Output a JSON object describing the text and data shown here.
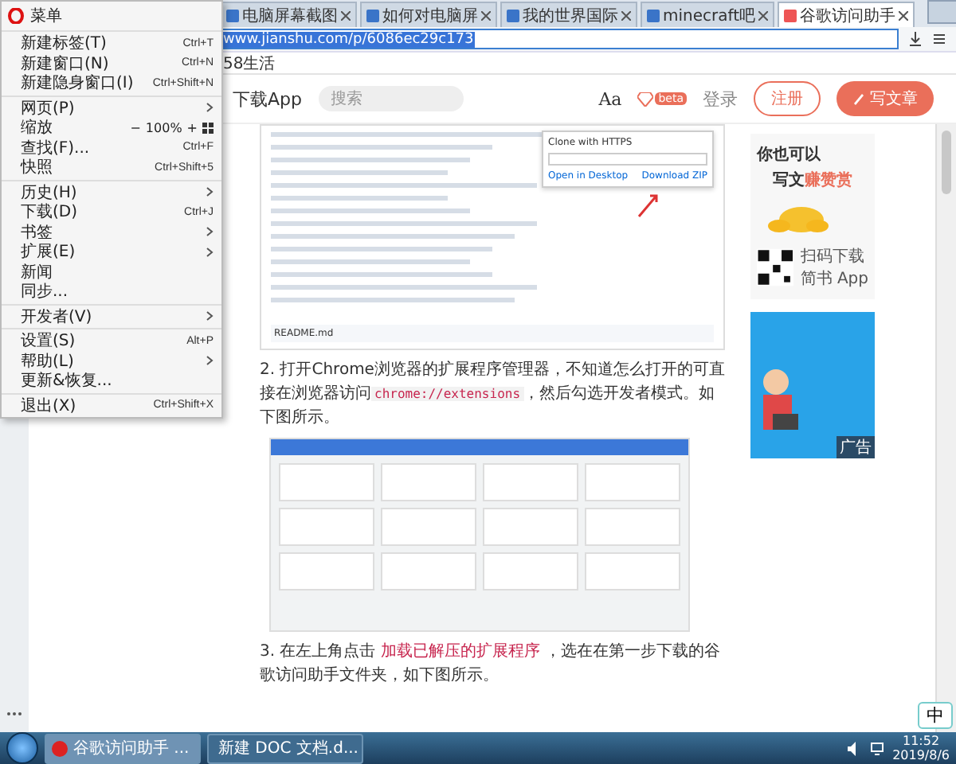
{
  "browser": {
    "tabs": [
      {
        "title": "电脑屏幕截图",
        "selected": false
      },
      {
        "title": "如何对电脑屏",
        "selected": false
      },
      {
        "title": "我的世界国际",
        "selected": false
      },
      {
        "title": "minecraft吧",
        "selected": false
      },
      {
        "title": "谷歌访问助手",
        "selected": true
      }
    ],
    "address": "www.jianshu.com/p/6086ec29c173",
    "bookmarks": [
      "58生活"
    ]
  },
  "menu": {
    "title": "菜单",
    "groups": [
      [
        {
          "kind": "item",
          "label": "新建标签(T)",
          "shortcut": "Ctrl+T"
        },
        {
          "kind": "item",
          "label": "新建窗口(N)",
          "shortcut": "Ctrl+N"
        },
        {
          "kind": "item",
          "label": "新建隐身窗口(I)",
          "shortcut": "Ctrl+Shift+N"
        }
      ],
      [
        {
          "kind": "submenu",
          "label": "网页(P)"
        },
        {
          "kind": "zoom",
          "label": "缩放",
          "minus": "−",
          "value": "100%",
          "plus": "+"
        },
        {
          "kind": "item",
          "label": "查找(F)...",
          "shortcut": "Ctrl+F"
        },
        {
          "kind": "item",
          "label": "快照",
          "shortcut": "Ctrl+Shift+5"
        }
      ],
      [
        {
          "kind": "submenu",
          "label": "历史(H)"
        },
        {
          "kind": "item",
          "label": "下载(D)",
          "shortcut": "Ctrl+J"
        },
        {
          "kind": "submenu",
          "label": "书签"
        },
        {
          "kind": "submenu",
          "label": "扩展(E)"
        },
        {
          "kind": "item",
          "label": "新闻"
        },
        {
          "kind": "item",
          "label": "同步..."
        }
      ],
      [
        {
          "kind": "submenu",
          "label": "开发者(V)"
        }
      ],
      [
        {
          "kind": "item",
          "label": "设置(S)",
          "shortcut": "Alt+P"
        },
        {
          "kind": "submenu",
          "label": "帮助(L)"
        },
        {
          "kind": "item",
          "label": "更新&恢复..."
        }
      ],
      [
        {
          "kind": "item",
          "label": "退出(X)",
          "shortcut": "Ctrl+Shift+X"
        }
      ]
    ]
  },
  "site_header": {
    "download_app": "下载App",
    "search_placeholder": "搜索",
    "font_button": "Aa",
    "beta_badge": "beta",
    "login": "登录",
    "register": "注册",
    "write": "写文章"
  },
  "article": {
    "screenshot_1": {
      "popup_title": "Clone with HTTPS",
      "open_desktop": "Open in Desktop",
      "download_zip": "Download ZIP",
      "readme": "README.md"
    },
    "steps": [
      {
        "number": "2.",
        "before": "打开Chrome浏览器的扩展程序管理器，不知道怎么打开的可直接在浏览器访问",
        "code": "chrome://extensions",
        "after": "，然后勾选开发者模式。如下图所示。"
      },
      {
        "number": "3.",
        "before": "在左上角点击",
        "code": "加载已解压的扩展程序",
        "after": "，选在在第一步下载的谷歌访问助手文件夹，如下图所示。"
      }
    ]
  },
  "ads": {
    "line_1": "你也可以",
    "line_2": "写文",
    "line_2_highlight": "赚赞赏",
    "qr_line_1": "扫码下载",
    "qr_line_2": "简书 App",
    "ad_label": "广告"
  },
  "ime": "中",
  "taskbar": {
    "tasks": [
      {
        "title": "谷歌访问助手 ...",
        "selected": true
      },
      {
        "title": "新建 DOC 文档.d...",
        "selected": false
      }
    ],
    "time": "11:52",
    "date": "2019/8/6"
  }
}
